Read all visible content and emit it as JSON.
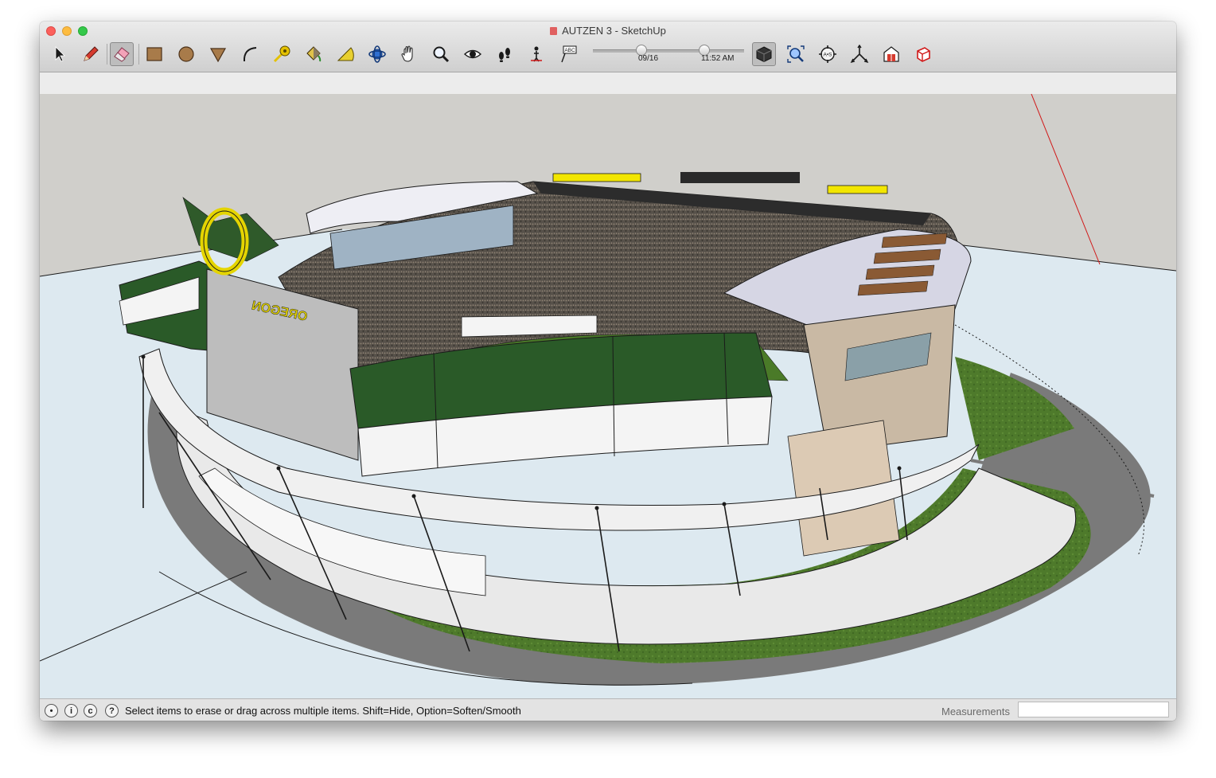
{
  "window": {
    "title": "AUTZEN 3 - SketchUp"
  },
  "toolbar": {
    "tools": [
      {
        "name": "select-tool",
        "icon": "arrow-cursor-icon"
      },
      {
        "name": "line-tool",
        "icon": "pencil-icon"
      },
      {
        "name": "eraser-tool",
        "icon": "eraser-icon",
        "active": true
      },
      {
        "name": "rectangle-tool",
        "icon": "rectangle-icon"
      },
      {
        "name": "circle-tool",
        "icon": "circle-icon"
      },
      {
        "name": "polygon-tool",
        "icon": "triangle-icon"
      },
      {
        "name": "arc-tool",
        "icon": "arc-icon"
      },
      {
        "name": "tape-measure-tool",
        "icon": "tape-measure-icon"
      },
      {
        "name": "paint-bucket-tool",
        "icon": "paint-bucket-icon"
      },
      {
        "name": "protractor-tool",
        "icon": "protractor-icon"
      },
      {
        "name": "orbit-tool",
        "icon": "orbit-icon"
      },
      {
        "name": "pan-tool",
        "icon": "hand-icon"
      },
      {
        "name": "zoom-tool",
        "icon": "magnifier-icon"
      },
      {
        "name": "look-around-tool",
        "icon": "eye-icon"
      },
      {
        "name": "walk-tool",
        "icon": "footprints-icon"
      },
      {
        "name": "position-camera-tool",
        "icon": "camera-position-icon"
      },
      {
        "name": "text-tool",
        "icon": "text-label-icon",
        "label": "ABC"
      }
    ],
    "shadow_settings": {
      "date_label": "09/16",
      "time_label": "11:52 AM"
    },
    "right_tools": [
      {
        "name": "section-display-tool",
        "icon": "cube-icon",
        "active": true
      },
      {
        "name": "zoom-extents-tool",
        "icon": "zoom-extents-icon"
      },
      {
        "name": "sandbox-tool",
        "icon": "target-icon",
        "label": "A•S"
      },
      {
        "name": "scale-tool",
        "icon": "axes-icon"
      },
      {
        "name": "get-models-tool",
        "icon": "warehouse-icon"
      },
      {
        "name": "view-iso-tool",
        "icon": "box-view-icon"
      }
    ]
  },
  "viewport": {
    "sign_text": "OREGON"
  },
  "statusbar": {
    "message": "Select items to erase or drag across multiple items. Shift=Hide, Option=Soften/Smooth",
    "help_icon": "?",
    "measurements_label": "Measurements",
    "measurements_value": ""
  },
  "colors": {
    "sky": "#d0cfcb",
    "ground": "#dde9f0",
    "grass": "#4f7a2a",
    "team_green": "#2a5a28",
    "team_yellow": "#f2e600",
    "crowd": "#5a5550",
    "red_axis": "#d01818"
  }
}
